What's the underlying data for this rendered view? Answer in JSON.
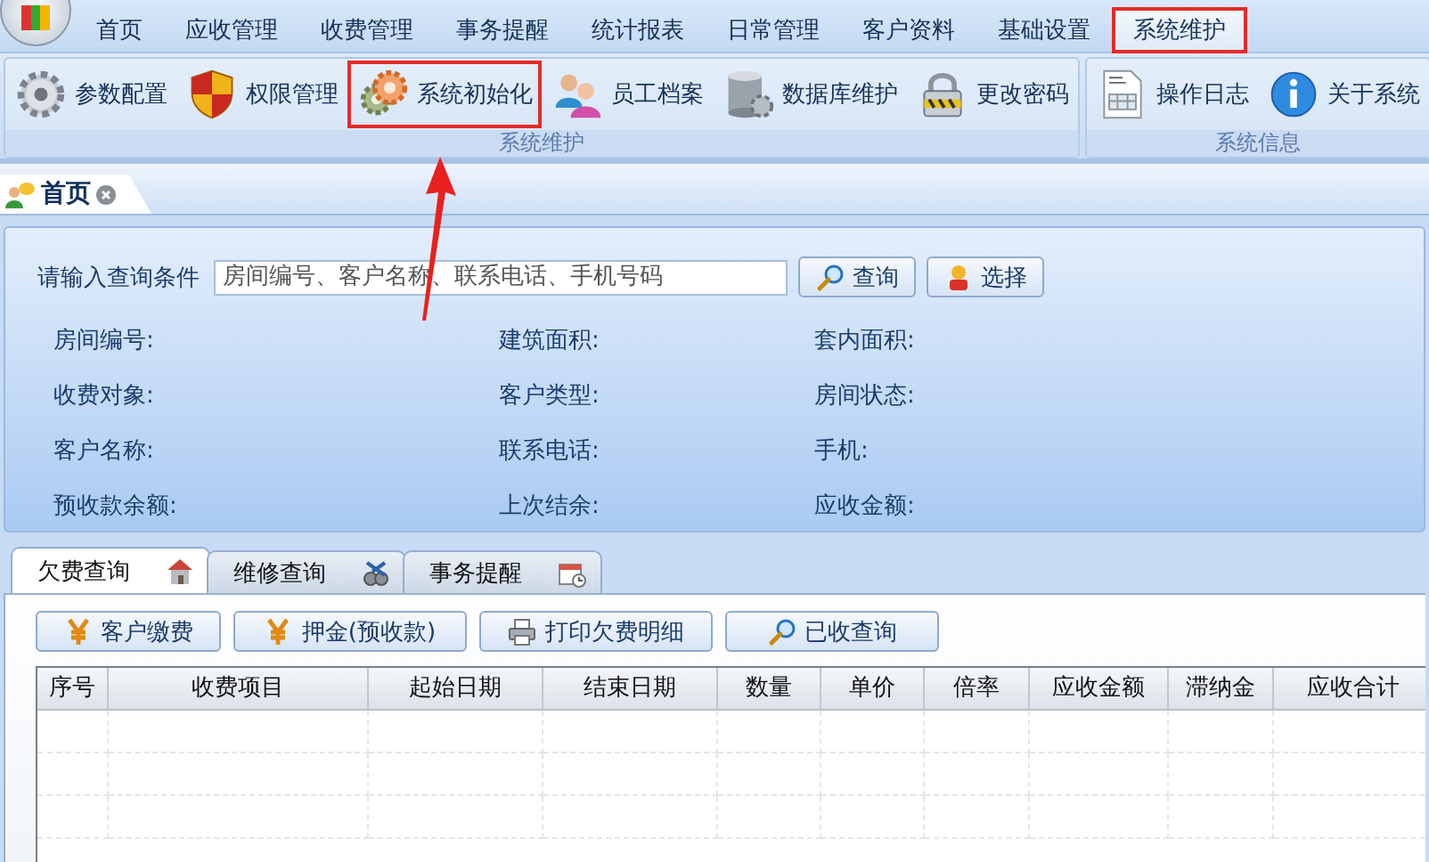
{
  "menu": [
    {
      "label": "首页",
      "selected": false
    },
    {
      "label": "应收管理",
      "selected": false
    },
    {
      "label": "收费管理",
      "selected": false
    },
    {
      "label": "事务提醒",
      "selected": false
    },
    {
      "label": "统计报表",
      "selected": false
    },
    {
      "label": "日常管理",
      "selected": false
    },
    {
      "label": "客户资料",
      "selected": false
    },
    {
      "label": "基础设置",
      "selected": false
    },
    {
      "label": "系统维护",
      "selected": true
    }
  ],
  "ribbon_groups": [
    {
      "title": "系统维护",
      "items": [
        {
          "label": "参数配置",
          "kind": "gear",
          "highlighted": false
        },
        {
          "label": "权限管理",
          "kind": "shield",
          "highlighted": false
        },
        {
          "label": "系统初始化",
          "kind": "gears",
          "highlighted": true
        },
        {
          "label": "员工档案",
          "kind": "people",
          "highlighted": false
        },
        {
          "label": "数据库维护",
          "kind": "database",
          "highlighted": false
        },
        {
          "label": "更改密码",
          "kind": "lock",
          "highlighted": false
        }
      ]
    },
    {
      "title": "系统信息",
      "items": [
        {
          "label": "操作日志",
          "kind": "document",
          "highlighted": false
        },
        {
          "label": "关于系统",
          "kind": "info",
          "highlighted": false
        }
      ]
    }
  ],
  "document_tabs": [
    {
      "label": "首页",
      "selected": true
    }
  ],
  "query": {
    "label": "请输入查询条件",
    "placeholder": "房间编号、客户名称、联系电话、手机号码",
    "buttons": [
      {
        "label": "查询",
        "kind": "search"
      },
      {
        "label": "选择",
        "kind": "person"
      }
    ]
  },
  "info_fields": [
    [
      "房间编号:",
      "建筑面积:",
      "套内面积:"
    ],
    [
      "收费对象:",
      "客户类型:",
      "房间状态:"
    ],
    [
      "客户名称:",
      "联系电话:",
      "手机:"
    ],
    [
      "预收款余额:",
      "上次结余:",
      "应收金额:"
    ]
  ],
  "bottom_tabs": [
    {
      "label": "欠费查询",
      "kind": "house",
      "selected": true
    },
    {
      "label": "维修查询",
      "kind": "tools",
      "selected": false
    },
    {
      "label": "事务提醒",
      "kind": "calendar",
      "selected": false
    }
  ],
  "action_buttons": [
    {
      "label": "客户缴费",
      "kind": "yen"
    },
    {
      "label": "押金(预收款)",
      "kind": "yen"
    },
    {
      "label": "打印欠费明细",
      "kind": "printer"
    },
    {
      "label": "已收查询",
      "kind": "search"
    }
  ],
  "table": {
    "columns": [
      "序号",
      "收费项目",
      "起始日期",
      "结束日期",
      "数量",
      "单价",
      "倍率",
      "应收金额",
      "滞纳金",
      "应收合计"
    ]
  },
  "annotation": {
    "arrow": true
  }
}
